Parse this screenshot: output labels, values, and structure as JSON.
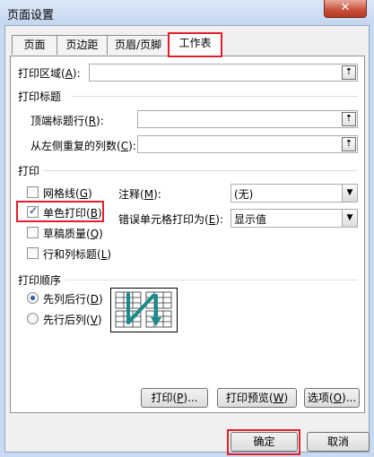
{
  "window": {
    "title": "页面设置",
    "close_glyph": "✕"
  },
  "tabs": [
    {
      "label": "页面",
      "active": false
    },
    {
      "label": "页边距",
      "active": false
    },
    {
      "label": "页眉/页脚",
      "active": false
    },
    {
      "label": "工作表",
      "active": true
    }
  ],
  "print_area": {
    "label": "打印区域",
    "key": "A",
    "value": ""
  },
  "print_titles": {
    "section": "打印标题",
    "rows_label": "顶端标题行",
    "rows_key": "R",
    "rows_value": "",
    "cols_label": "从左侧重复的列数",
    "cols_key": "C",
    "cols_value": ""
  },
  "print": {
    "section": "打印",
    "gridlines": {
      "label": "网格线",
      "key": "G",
      "checked": false
    },
    "black_white": {
      "label": "单色打印",
      "key": "B",
      "checked": true
    },
    "draft": {
      "label": "草稿质量",
      "key": "Q",
      "checked": false
    },
    "headings": {
      "label": "行和列标题",
      "key": "L",
      "checked": false
    },
    "comments_label": "注释",
    "comments_key": "M",
    "comments_value": "(无)",
    "errors_label": "错误单元格打印为",
    "errors_key": "E",
    "errors_value": "显示值"
  },
  "page_order": {
    "section": "打印顺序",
    "down_then_over": {
      "label": "先列后行",
      "key": "D",
      "selected": true
    },
    "over_then_down": {
      "label": "先行后列",
      "key": "V",
      "selected": false
    }
  },
  "buttons": {
    "print": {
      "label": "打印",
      "key": "P"
    },
    "preview": {
      "label": "打印预览",
      "key": "W"
    },
    "options": {
      "label": "选项",
      "key": "O"
    },
    "ok": "确定",
    "cancel": "取消"
  },
  "colors": {
    "highlight": "#e3202a",
    "preview_arrow": "#1a8a8a"
  },
  "icons": {
    "collapse": "collapse-dialog-icon",
    "dropdown": "chevron-down-icon"
  }
}
